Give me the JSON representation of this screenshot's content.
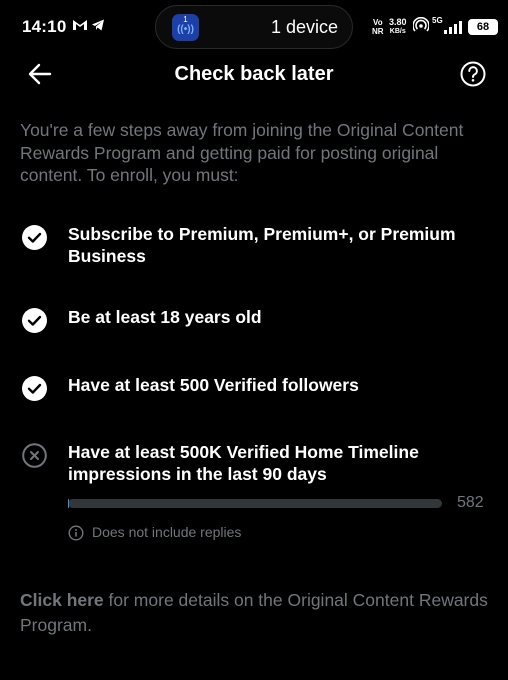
{
  "status_bar": {
    "time": "14:10",
    "icons": [
      "gmail-icon",
      "telegram-icon"
    ],
    "island_badge_number": "1",
    "island_text": "1 device",
    "network_top": "Vo",
    "network_bottom": "NR",
    "speed_value": "3.80",
    "speed_unit": "KB/s",
    "signal_label": "5G",
    "battery": "68"
  },
  "header": {
    "title": "Check back later"
  },
  "intro": "You're a few steps away from joining the Original Content Rewards Program and getting paid for posting original content. To enroll, you must:",
  "requirements": [
    {
      "label": "Subscribe to Premium, Premium+, or Premium Business",
      "status": "met"
    },
    {
      "label": "Be at least 18 years old",
      "status": "met"
    },
    {
      "label": "Have at least 500 Verified followers",
      "status": "met"
    },
    {
      "label": "Have at least 500K Verified Home Timeline impressions in the last 90 days",
      "status": "not_met"
    }
  ],
  "progress": {
    "value": "582",
    "fraction": 0.0012
  },
  "note": "Does not include replies",
  "footer": {
    "link": "Click here",
    "text": " for more details on the Original Content Rewards Program."
  },
  "colors": {
    "background": "#000000",
    "primary_text": "#ffffff",
    "secondary_text": "#71767b",
    "track": "#333639"
  }
}
